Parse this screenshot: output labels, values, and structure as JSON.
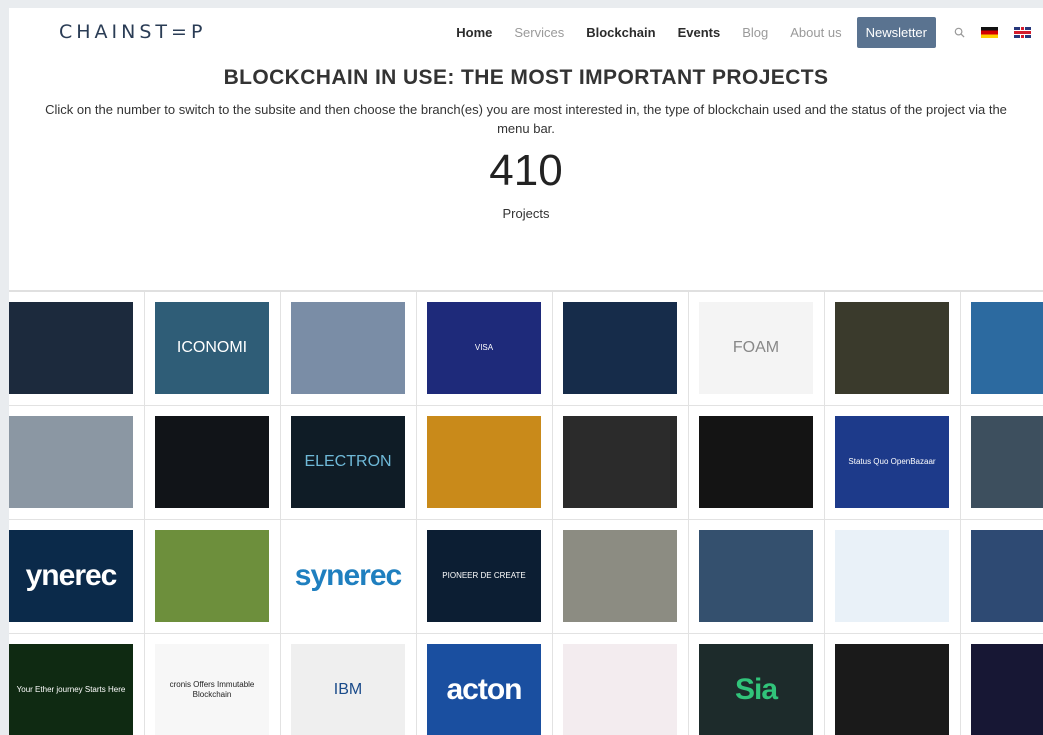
{
  "brand": {
    "logo_text": "CHAINST=P"
  },
  "nav": {
    "items": [
      {
        "label": "Home",
        "active": true
      },
      {
        "label": "Services",
        "active": false
      },
      {
        "label": "Blockchain",
        "active": true
      },
      {
        "label": "Events",
        "active": true
      },
      {
        "label": "Blog",
        "active": false
      },
      {
        "label": "About us",
        "active": false
      }
    ],
    "newsletter_label": "Newsletter",
    "icons": [
      "search-icon",
      "flag-de-icon",
      "flag-uk-icon"
    ]
  },
  "hero": {
    "title": "BLOCKCHAIN IN USE: THE MOST IMPORTANT PROJECTS",
    "intro": "Click on the number to switch to the subsite and then choose the branch(es) you are most interested in, the type of blockchain used and the status of the project via the menu bar.",
    "count": "410",
    "count_label": "Projects"
  },
  "colors": {
    "accent": "#5a7390",
    "brand": "#2a3c55"
  },
  "grid": {
    "tiles": [
      {
        "name": "news-report",
        "bg": "#1c2a3d",
        "text": "",
        "text_class": "tt-sm"
      },
      {
        "name": "iconomi",
        "bg": "#2f5d77",
        "text": "ICONOMI",
        "text_class": "tt-mid"
      },
      {
        "name": "city-building",
        "bg": "#7a8da6",
        "text": "",
        "text_class": "tt-sm"
      },
      {
        "name": "visa-flow",
        "bg": "#1e2a7a",
        "text": "VISA",
        "text_class": "tt-sm"
      },
      {
        "name": "web-dashboard",
        "bg": "#162c4a",
        "text": "",
        "text_class": "tt-sm"
      },
      {
        "name": "foam",
        "bg": "#f4f4f4",
        "text": "FOAM",
        "text_class": "tt-mid",
        "fg": "#888"
      },
      {
        "name": "dark-photo",
        "bg": "#3a3a2c",
        "text": "",
        "text_class": "tt-sm"
      },
      {
        "name": "teal-site",
        "bg": "#2c6aa0",
        "text": "",
        "text_class": "tt-sm"
      },
      {
        "name": "city-skyline",
        "bg": "#8b97a3",
        "text": "",
        "text_class": "tt-sm"
      },
      {
        "name": "dark-lotus",
        "bg": "#111418",
        "text": "",
        "text_class": "tt-sm"
      },
      {
        "name": "electron",
        "bg": "#0f1c26",
        "text": "ELECTRON",
        "text_class": "tt-mid",
        "fg": "#6fb9d8"
      },
      {
        "name": "sunset-road",
        "bg": "#c98a1a",
        "text": "",
        "text_class": "tt-sm"
      },
      {
        "name": "network-bike",
        "bg": "#2b2b2b",
        "text": "",
        "text_class": "tt-sm"
      },
      {
        "name": "dark-stage",
        "bg": "#141414",
        "text": "",
        "text_class": "tt-sm"
      },
      {
        "name": "status-quo-openbazaar",
        "bg": "#1d3a8a",
        "text": "Status Quo   OpenBazaar",
        "text_class": "tt-sm"
      },
      {
        "name": "grey-site",
        "bg": "#3d4f5e",
        "text": "",
        "text_class": "tt-sm"
      },
      {
        "name": "synereo-hand",
        "bg": "#0b2a4a",
        "text": "ynerec",
        "text_class": "tt-big"
      },
      {
        "name": "news-field",
        "bg": "#6d8f3c",
        "text": "",
        "text_class": "tt-sm"
      },
      {
        "name": "synereo-logo",
        "bg": "#ffffff",
        "text": "synerec",
        "text_class": "tt-big",
        "fg": "#1f7fbf"
      },
      {
        "name": "pioneer",
        "bg": "#0c1e33",
        "text": "PIONEER DE CREATE",
        "text_class": "tt-sm"
      },
      {
        "name": "crystals",
        "bg": "#8c8c82",
        "text": "",
        "text_class": "tt-sm"
      },
      {
        "name": "city-collage",
        "bg": "#34506e",
        "text": "",
        "text_class": "tt-sm"
      },
      {
        "name": "blue-network",
        "bg": "#e9f1f8",
        "text": "",
        "text_class": "tt-sm"
      },
      {
        "name": "harbor-night",
        "bg": "#2e4a73",
        "text": "",
        "text_class": "tt-sm"
      },
      {
        "name": "green-space",
        "bg": "#0f2a12",
        "text": "Your Ether journey Starts Here",
        "text_class": "tt-sm"
      },
      {
        "name": "acronis-news",
        "bg": "#f7f7f7",
        "text": "cronis Offers Immutable Blockchain",
        "text_class": "tt-sm",
        "fg": "#222"
      },
      {
        "name": "ibm-article",
        "bg": "#efefef",
        "text": "IBM",
        "text_class": "tt-mid",
        "fg": "#1a4b8a"
      },
      {
        "name": "acton",
        "bg": "#1a4fa0",
        "text": "acton",
        "text_class": "tt-big"
      },
      {
        "name": "pink-site",
        "bg": "#f3ecef",
        "text": "",
        "text_class": "tt-sm"
      },
      {
        "name": "sia",
        "bg": "#1d2b2b",
        "text": "Sia",
        "text_class": "tt-big",
        "fg": "#31c47a"
      },
      {
        "name": "diamonds",
        "bg": "#1a1a1a",
        "text": "",
        "text_class": "tt-sm"
      },
      {
        "name": "dark-bars",
        "bg": "#171734",
        "text": "",
        "text_class": "tt-sm"
      }
    ]
  }
}
